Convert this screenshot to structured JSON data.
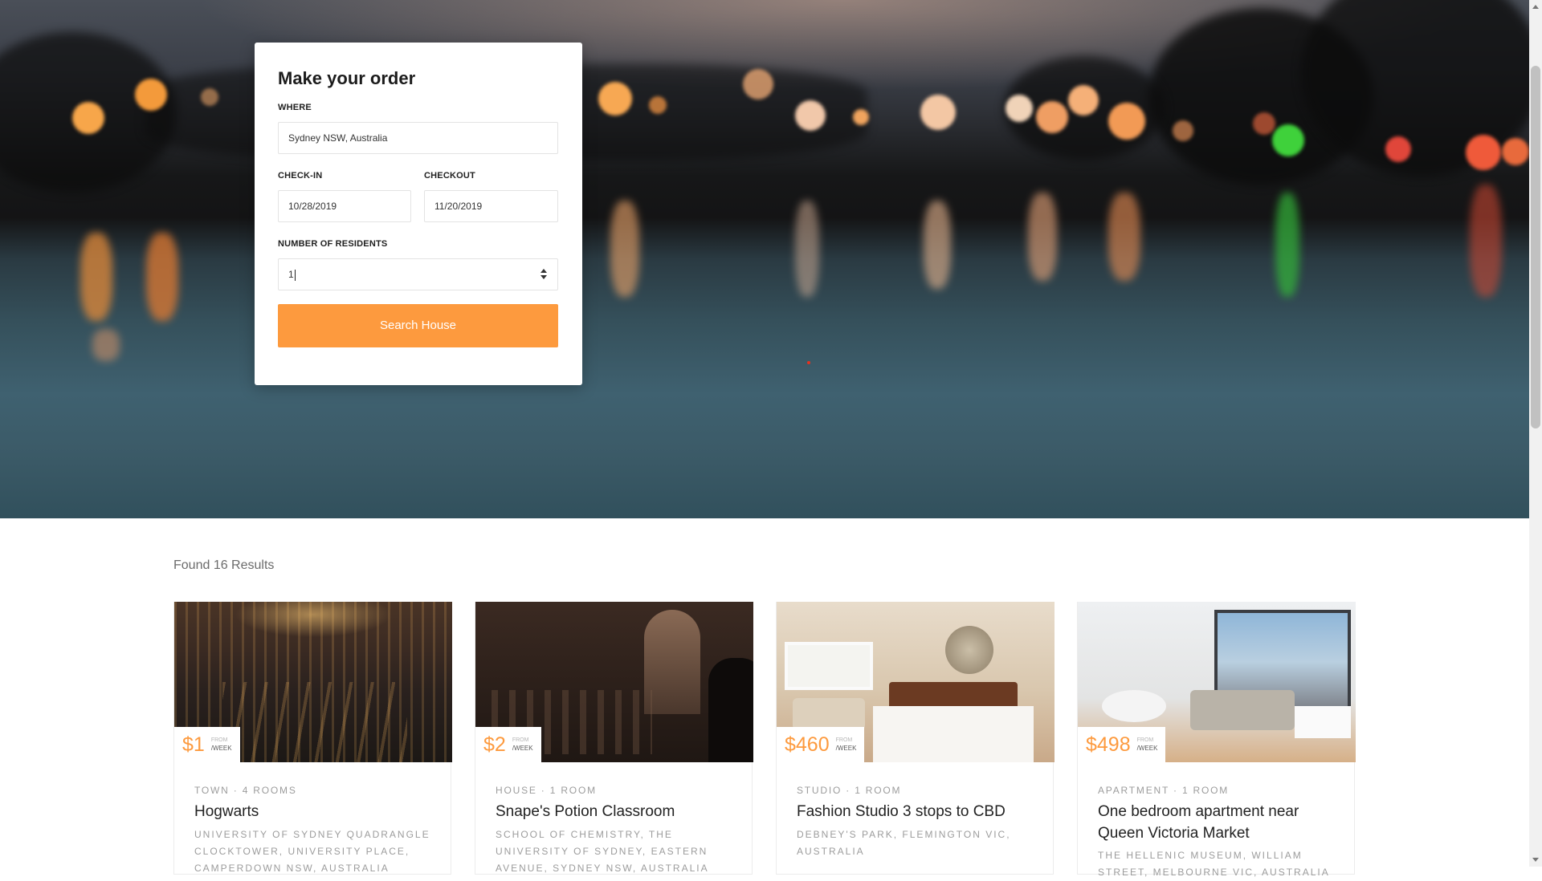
{
  "order_form": {
    "title": "Make your order",
    "where_label": "WHERE",
    "where_value": "Sydney NSW, Australia",
    "checkin_label": "CHECK-IN",
    "checkin_value": "10/28/2019",
    "checkout_label": "CHECKOUT",
    "checkout_value": "11/20/2019",
    "residents_label": "NUMBER OF RESIDENTS",
    "residents_value": "1",
    "search_button": "Search House"
  },
  "results": {
    "count_text": "Found 16 Results",
    "cards": [
      {
        "price": "$1",
        "from": "FROM",
        "per": "/WEEK",
        "meta": "TOWN · 4 ROOMS",
        "title": "Hogwarts",
        "address": "UNIVERSITY OF SYDNEY QUADRANGLE CLOCKTOWER, UNIVERSITY PLACE, CAMPERDOWN NSW, AUSTRALIA"
      },
      {
        "price": "$2",
        "from": "FROM",
        "per": "/WEEK",
        "meta": "HOUSE · 1 ROOM",
        "title": "Snape's Potion Classroom",
        "address": "SCHOOL OF CHEMISTRY, THE UNIVERSITY OF SYDNEY, EASTERN AVENUE, SYDNEY NSW, AUSTRALIA"
      },
      {
        "price": "$460",
        "from": "FROM",
        "per": "/WEEK",
        "meta": "STUDIO · 1 ROOM",
        "title": "Fashion Studio 3 stops to CBD",
        "address": "DEBNEY'S PARK, FLEMINGTON VIC, AUSTRALIA"
      },
      {
        "price": "$498",
        "from": "FROM",
        "per": "/WEEK",
        "meta": "APARTMENT · 1 ROOM",
        "title": "One bedroom apartment near Queen Victoria Market",
        "address": "THE HELLENIC MUSEUM, WILLIAM STREET, MELBOURNE VIC, AUSTRALIA"
      }
    ]
  },
  "colors": {
    "accent": "#fd9a3e",
    "text_dark": "#222222",
    "text_muted": "#9c9c9c"
  }
}
